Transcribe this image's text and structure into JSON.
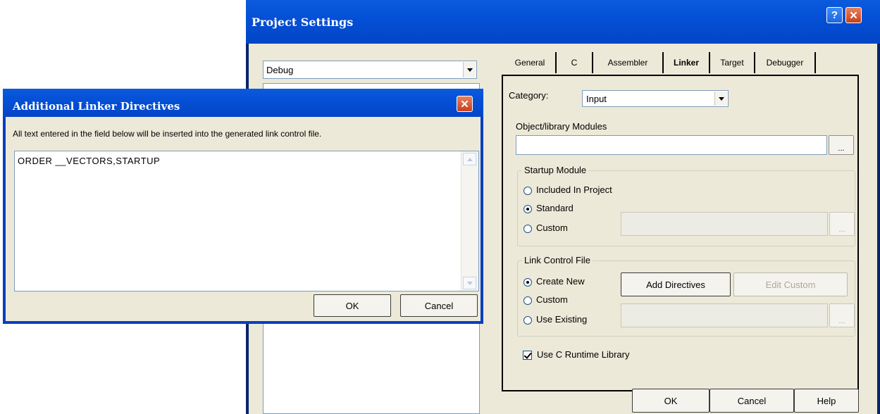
{
  "project_settings": {
    "title": "Project Settings",
    "help_glyph": "?",
    "close_glyph": "✕",
    "configuration": "Debug",
    "tabs": [
      {
        "label": "General"
      },
      {
        "label": "C"
      },
      {
        "label": "Assembler"
      },
      {
        "label": "Linker",
        "active": true
      },
      {
        "label": "Target"
      },
      {
        "label": "Debugger"
      }
    ],
    "linker": {
      "category_label": "Category:",
      "category_value": "Input",
      "object_modules_label": "Object/library Modules",
      "object_modules_value": "",
      "ellipsis": "...",
      "startup_group": "Startup Module",
      "startup_options": [
        {
          "label": "Included In Project",
          "checked": false
        },
        {
          "label": "Standard",
          "checked": true
        },
        {
          "label": "Custom",
          "checked": false
        }
      ],
      "link_control_group": "Link Control File",
      "link_options": [
        {
          "label": "Create New",
          "checked": true
        },
        {
          "label": "Custom",
          "checked": false
        },
        {
          "label": "Use Existing",
          "checked": false
        }
      ],
      "add_directives_label": "Add Directives",
      "edit_custom_label": "Edit Custom",
      "use_c_runtime_label": "Use C Runtime Library",
      "use_c_runtime_checked": true
    },
    "buttons": {
      "ok": "OK",
      "cancel": "Cancel",
      "help": "Help"
    }
  },
  "linker_directives_dialog": {
    "title": "Additional Linker Directives",
    "close_glyph": "✕",
    "description": "All text entered in the field below will be inserted into the generated link control file.",
    "text_value": "ORDER __VECTORS,STARTUP",
    "ok_label": "OK",
    "cancel_label": "Cancel"
  },
  "colors": {
    "titlebar_blue": "#0450d6",
    "dialog_face": "#ece9d8",
    "close_red": "#c8401c"
  }
}
